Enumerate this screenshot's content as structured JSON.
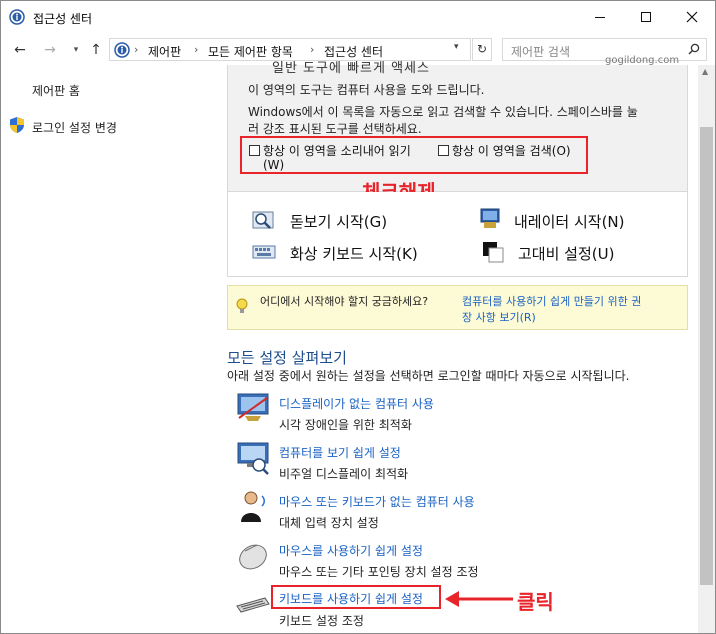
{
  "window": {
    "title": "접근성 센터"
  },
  "nav": {
    "breadcrumbs": [
      "제어판",
      "모든 제어판 항목",
      "접근성 센터"
    ],
    "search_placeholder": "제어판 검색",
    "watermark": "gogildong.com"
  },
  "sidebar": {
    "home": "제어판 홈",
    "login": "로그인 설정 변경"
  },
  "top_panel": {
    "cut_heading": "일반 도구에 빠르게 액세스",
    "line1": "이 영역의 도구는 컴퓨터 사용을 도와 드립니다.",
    "line2": "Windows에서 이 목록을 자동으로 읽고 검색할 수 있습니다. 스페이스바를 눌",
    "line3": "러 강조 표시된 도구를 선택하세요.",
    "cb1_label_a": "항상 이 영역을 소리내어 읽기",
    "cb1_label_b": "(W)",
    "cb2_label": "항상 이 영역을 검색(O)",
    "cb1_checked": false,
    "cb2_checked": false,
    "annotation": "체크해제"
  },
  "tools": [
    {
      "label": "돋보기 시작(G)",
      "icon": "magnifier-icon"
    },
    {
      "label": "내레이터 시작(N)",
      "icon": "narrator-icon"
    },
    {
      "label": "화상 키보드 시작(K)",
      "icon": "onscreen-keyboard-icon"
    },
    {
      "label": "고대비 설정(U)",
      "icon": "high-contrast-icon"
    }
  ],
  "tip": {
    "question": "어디에서 시작해야 할지 궁금하세요?",
    "link_line1": "컴퓨터를 사용하기 쉽게 만들기 위한 권",
    "link_line2": "장 사항 보기(R)"
  },
  "all_settings": {
    "title": "모든 설정 살펴보기",
    "desc": "아래 설정 중에서 원하는 설정을 선택하면 로그인할 때마다 자동으로 시작됩니다.",
    "items": [
      {
        "link": "디스플레이가 없는 컴퓨터 사용",
        "sub": "시각 장애인을 위한 최적화",
        "icon": "no-display-icon"
      },
      {
        "link": "컴퓨터를 보기 쉽게 설정",
        "sub": "비주얼 디스플레이 최적화",
        "icon": "display-icon"
      },
      {
        "link": "마우스 또는 키보드가 없는 컴퓨터 사용",
        "sub": "대체 입력 장치 설정",
        "icon": "speech-user-icon"
      },
      {
        "link": "마우스를 사용하기 쉽게 설정",
        "sub": "마우스 또는 기타 포인팅 장치 설정 조정",
        "icon": "mouse-icon"
      },
      {
        "link": "키보드를 사용하기 쉽게 설정",
        "sub": "키보드 설정 조정",
        "icon": "keyboard-icon"
      }
    ],
    "click_annotation": "클릭"
  },
  "colors": {
    "link": "#1a62c4",
    "annotation_red": "#e8232a",
    "tip_bg": "#fdfbd6"
  }
}
